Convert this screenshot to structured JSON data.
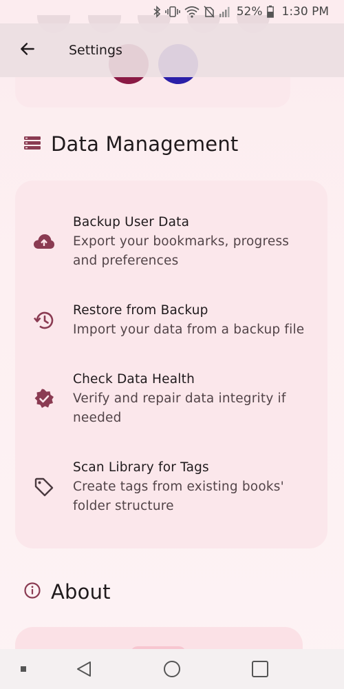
{
  "status_bar": {
    "battery_pct": "52%",
    "time": "1:30 PM",
    "icons": [
      "bluetooth-icon",
      "vibrate-icon",
      "wifi-icon",
      "no-sim-icon",
      "signal-icon",
      "battery-icon"
    ]
  },
  "app_bar": {
    "title": "Settings",
    "back_icon": "arrow-back-icon"
  },
  "data_management": {
    "title": "Data Management",
    "icon": "storage-icon",
    "items": [
      {
        "title": "Backup User Data",
        "subtitle_lines": [
          "Export your bookmarks, progress",
          "and preferences"
        ],
        "icon": "cloud-upload-icon"
      },
      {
        "title": "Restore from Backup",
        "subtitle_lines": [
          "Import your data from a backup file"
        ],
        "icon": "history-icon"
      },
      {
        "title": "Check Data Health",
        "subtitle_lines": [
          "Verify and repair data integrity if",
          "needed"
        ],
        "icon": "verified-icon"
      },
      {
        "title": "Scan Library for Tags",
        "subtitle_lines": [
          "Create tags from existing books'",
          "folder structure"
        ],
        "icon": "tag-icon"
      }
    ]
  },
  "about": {
    "title": "About",
    "icon": "info-icon"
  },
  "nav_bar": {
    "buttons": [
      "recents-dot-icon",
      "back-triangle-icon",
      "home-circle-icon",
      "overview-square-icon"
    ]
  },
  "colors": {
    "accent": "#8a3b52",
    "background": "#fdf0f2",
    "card": "#fbe7eb",
    "app_bar": "#ecdee2"
  }
}
